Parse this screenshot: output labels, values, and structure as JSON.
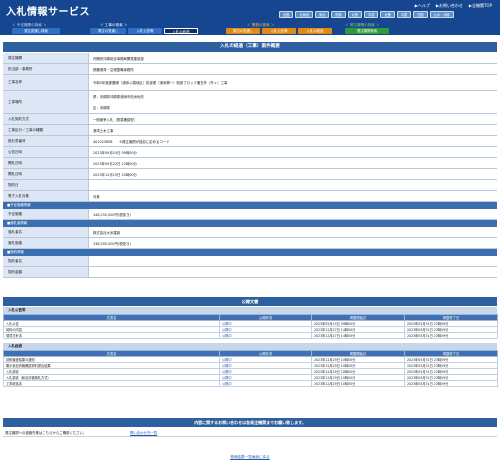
{
  "header": {
    "title": "入札情報サービス",
    "util_links": [
      "▶ヘルプ",
      "▶お問い合わせ",
      "▶全機関TOP"
    ],
    "regions": [
      "全国",
      "北海道",
      "東北",
      "関東",
      "北陸",
      "中部",
      "近畿",
      "中国",
      "四国",
      "九州・沖縄"
    ]
  },
  "menu": {
    "groups": [
      "＜ 予定機関の検索 ＞",
      "＜ 工事の検索 ＞",
      "＜ 業務の検索 ＞",
      "＜ 発注機関の検索 ＞"
    ],
    "tabs": [
      "発注見通し検索",
      "発注の見通し",
      "入札公告等",
      "入札の経過",
      "発注の見通し",
      "入札公告等",
      "入札の経過",
      "発注機関検索"
    ]
  },
  "main_title": "入札の経過（工事）案件概要",
  "details": [
    {
      "label": "発注機関",
      "value": "内閣府沖縄総合事務局開発建設部"
    },
    {
      "label": "担当部・事務所",
      "value": "那覇港湾・空港整備事務所"
    },
    {
      "label": "工事名称",
      "value": "令和5年度那覇港（浦添ふ頭地区）防波堤（浦添第一）既設ブロック撤去外（外ヶ）工事"
    },
    {
      "label": "工事場所",
      "value": "県：沖縄県沖縄県浦添市西洲地先",
      "value2": "区：沖縄県"
    },
    {
      "label": "入札契約方式",
      "value": "一般競争入札（簡易確認型）"
    },
    {
      "label": "工事区分／工事の種類",
      "value": "港湾土木工事"
    },
    {
      "label": "設計書番号",
      "value": "401023658　　※発注機関が独自に定めるコード"
    },
    {
      "label": "公告日時",
      "value": "2023年09月15日 09時00分"
    },
    {
      "label": "開札日時",
      "value": "2023年09月22日 12時00分"
    },
    {
      "label": "開札日時",
      "value": "2023年12月15日 10時00分"
    },
    {
      "label": "契約日",
      "value": ""
    },
    {
      "label": "電子入札対象",
      "value": "対象"
    }
  ],
  "sections": {
    "yotei": "■予定価格情報",
    "rakusatsu": "■落札者情報",
    "keiyaku": "■契約情報"
  },
  "yotei_rows": [
    {
      "label": "予定価格",
      "value": "148,250,000円(税抜き)"
    }
  ],
  "rakusatsu_rows": [
    {
      "label": "落札者名",
      "value": "株式会社大米建設"
    },
    {
      "label": "落札価格",
      "value": "138,000,000円(税抜き)"
    }
  ],
  "keiyaku_rows": [
    {
      "label": "契約者名",
      "value": ""
    },
    {
      "label": "契約金額",
      "value": ""
    }
  ],
  "public_docs": {
    "title": "公開文書",
    "columns": [
      "文書名",
      "公開状況",
      "掲載開始日",
      "掲載終了日"
    ],
    "group1": {
      "title": "入札公告等",
      "rows": [
        [
          "入札公告",
          "公開中",
          "2023年09月15日 09時00分",
          "2023年05月31日 23時59分"
        ],
        [
          "契約の内容",
          "公開中",
          "2023年12月27日 14時50分",
          "2023年05月31日 23時59分"
        ],
        [
          "環境方針書",
          "公開中",
          "2023年12月27日 14時50分",
          "2023年05月31日 23時59分"
        ]
      ]
    },
    "group2": {
      "title": "入札経過",
      "rows": [
        [
          "技術審査結果の通知",
          "公開中",
          "2023年12月29日 10時00分",
          "2023年05月31日 23時59分"
        ],
        [
          "開示参加資格確認資料提出結果",
          "公開中",
          "2023年12月29日 10時00分",
          "2023年05月31日 23時59分"
        ],
        [
          "入札調書",
          "公開中",
          "2023年12月29日 10時00分",
          "2023年05月31日 23時59分"
        ],
        [
          "入札調書（総合評価落札方式）",
          "公開中",
          "2023年12月29日 10時00分",
          "2023年05月31日 23時59分"
        ],
        [
          "工事総括書",
          "公開中",
          "2023年12月29日 10時00分",
          "2023年05月31日 23時59分"
        ]
      ]
    }
  },
  "contact": {
    "title": "内容に関するお問い合わせは各発注機関までお願い致します。",
    "text": "発注機関への連絡先等はこちらからご確認ください。",
    "link": "問い合わせ先一覧"
  },
  "footer": {
    "back": "検索結果一覧画面に戻る"
  }
}
